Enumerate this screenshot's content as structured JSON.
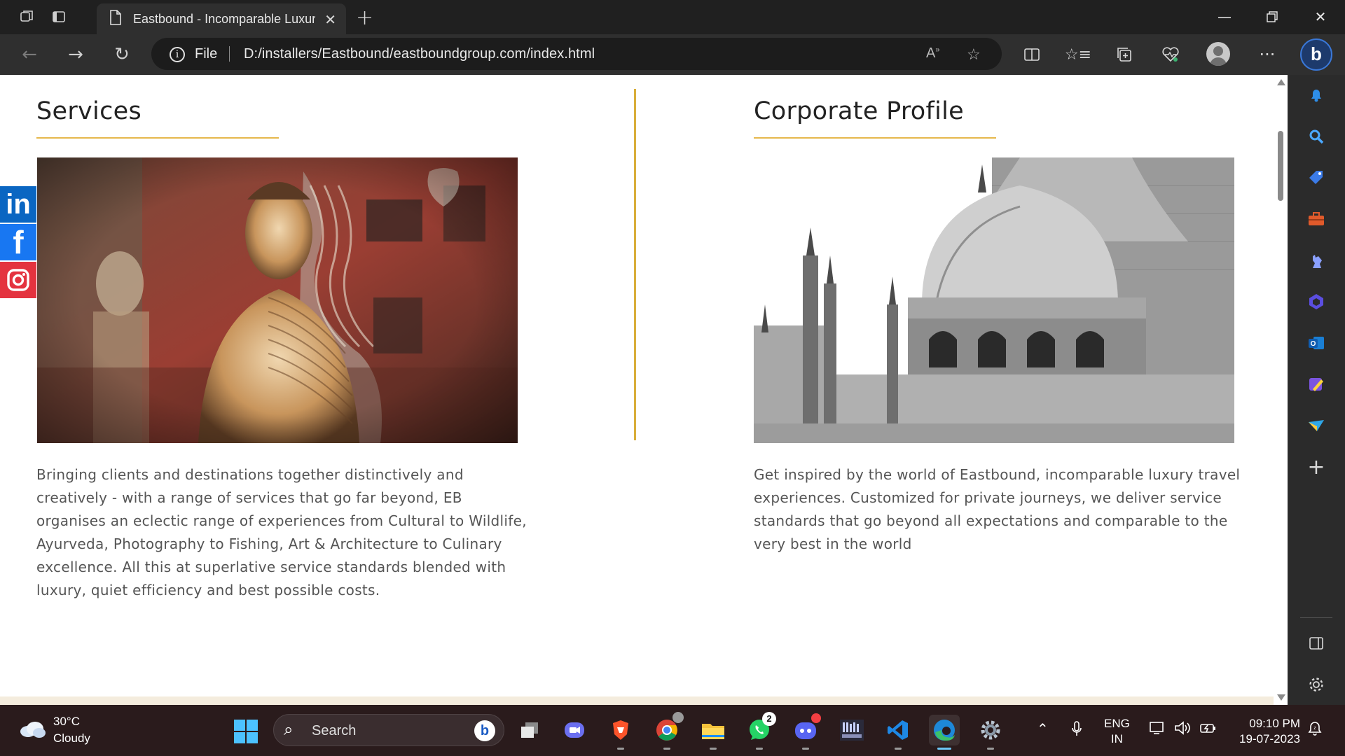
{
  "browser": {
    "tab_title": "Eastbound - Incomparable Luxury",
    "address_scheme": "File",
    "url": "D:/installers/Eastbound/eastboundgroup.com/index.html"
  },
  "page": {
    "services": {
      "title": "Services",
      "text": "Bringing clients and destinations together distinctively and creatively - with a range of services that go far beyond, EB organises an eclectic range of experiences from Cultural to Wildlife, Ayurveda, Photography to Fishing, Art & Architecture to Culinary excellence. All this at superlative service standards blended with luxury, quiet efficiency and best possible costs."
    },
    "corporate_profile": {
      "title": "Corporate Profile",
      "text": "Get inspired by the world of Eastbound, incomparable luxury travel experiences. Customized for private journeys, we deliver service standards that go beyond all expectations and comparable to the very best in the world"
    },
    "social": {
      "linkedin": "in",
      "facebook": "f"
    },
    "colors": {
      "accent_gold": "#d9ae3a",
      "body_text": "#555555"
    }
  },
  "taskbar": {
    "weather_temp": "30°C",
    "weather_desc": "Cloudy",
    "search_label": "Search",
    "whatsapp_badge": "2",
    "language": "ENG",
    "region": "IN",
    "time": "09:10 PM",
    "date": "19-07-2023"
  }
}
